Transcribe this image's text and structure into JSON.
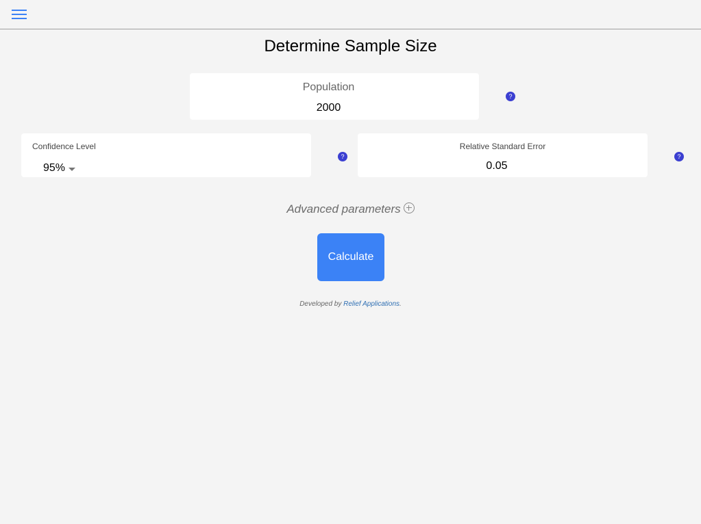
{
  "header": {
    "menu_icon": "hamburger-menu-icon",
    "accent_color": "#3b82f6"
  },
  "page": {
    "title": "Determine Sample Size"
  },
  "population": {
    "label": "Population",
    "value": "2000",
    "help_icon": "question-mark-icon",
    "help_label": "?"
  },
  "confidence": {
    "label": "Confidence Level",
    "selected": "95%",
    "help_label": "?"
  },
  "relative_error": {
    "label": "Relative Standard Error",
    "value": "0.05",
    "help_label": "?"
  },
  "advanced": {
    "label": "Advanced parameters",
    "icon": "plus-circle-icon"
  },
  "actions": {
    "calculate_label": "Calculate",
    "button_color": "#3b82f6"
  },
  "footer": {
    "prefix": "Developed by ",
    "link_text": "Relief Applications",
    "suffix": "."
  }
}
